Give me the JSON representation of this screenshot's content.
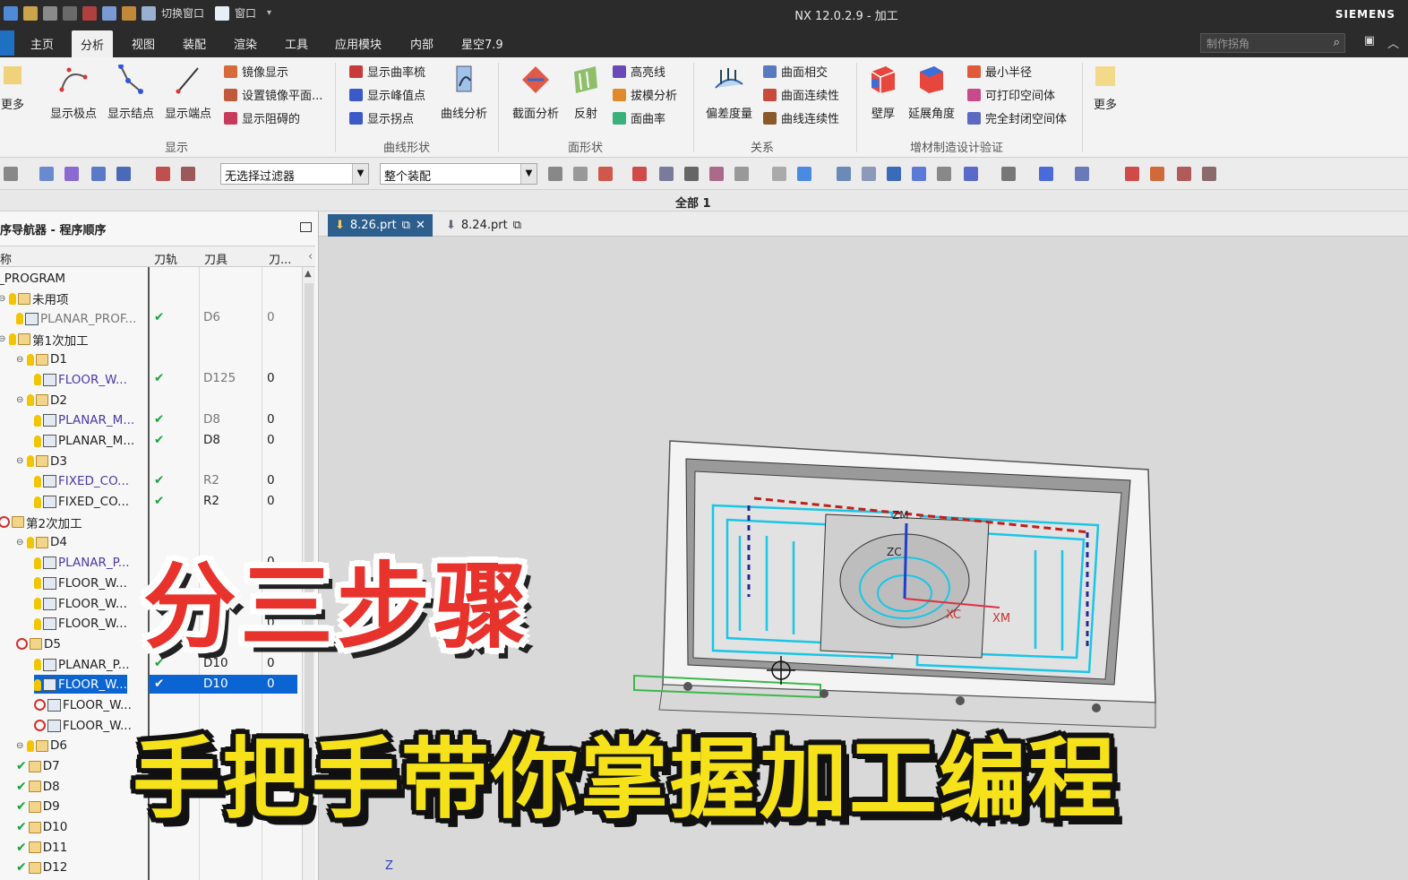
{
  "titlebar": {
    "quick_switch": "切换窗口",
    "quick_window": "窗口",
    "title": "NX 12.0.2.9 - 加工",
    "brand": "SIEMENS"
  },
  "menu": {
    "tabs": [
      "主页",
      "分析",
      "视图",
      "装配",
      "渲染",
      "工具",
      "应用模块",
      "内部",
      "星空7.9"
    ],
    "active": "分析",
    "search_placeholder": "制作拐角"
  },
  "ribbon": {
    "more_left": "更多",
    "display_group": {
      "label": "显示",
      "big_buttons": [
        "显示极点",
        "显示结点",
        "显示端点"
      ],
      "small_items": [
        "镜像显示",
        "设置镜像平面...",
        "显示阻碍的"
      ]
    },
    "curve_group": {
      "label": "曲线形状",
      "small_items": [
        "显示曲率梳",
        "显示峰值点",
        "显示拐点"
      ],
      "big_button": "曲线分析"
    },
    "face_group": {
      "label": "面形状",
      "big_buttons": [
        "截面分析",
        "反射"
      ],
      "small_items": [
        "高亮线",
        "拔模分析",
        "面曲率"
      ]
    },
    "relation_group": {
      "label": "关系",
      "big_button": "偏差度量",
      "small_items": [
        "曲面相交",
        "曲面连续性",
        "曲线连续性"
      ]
    },
    "additive_group": {
      "label": "增材制造设计验证",
      "big_buttons": [
        "壁厚",
        "延展角度"
      ],
      "small_items": [
        "最小半径",
        "可打印空间体",
        "完全封闭空间体"
      ]
    },
    "more_right": "更多"
  },
  "toolbar": {
    "filter": "无选择过滤器",
    "assembly": "整个装配"
  },
  "status": "全部 1",
  "navigator": {
    "title": "序导航器 - 程序顺序",
    "columns": [
      "称",
      "刀轨",
      "刀具",
      "刀..."
    ],
    "rows": [
      {
        "indent": 0,
        "name": "_PROGRAM",
        "kind": "root",
        "path": "",
        "tool": "",
        "n": ""
      },
      {
        "indent": 0,
        "name": "未用项",
        "kind": "folder",
        "path": "",
        "tool": "",
        "n": ""
      },
      {
        "indent": 1,
        "name": "PLANAR_PROF...",
        "kind": "op-muted",
        "path": "✔",
        "tool": "D6",
        "n": "0"
      },
      {
        "indent": 0,
        "name": "第1次加工",
        "kind": "folder",
        "path": "",
        "tool": "",
        "n": ""
      },
      {
        "indent": 1,
        "name": "D1",
        "kind": "folder",
        "path": "",
        "tool": "",
        "n": ""
      },
      {
        "indent": 2,
        "name": "FLOOR_W...",
        "kind": "op-purple",
        "path": "✔",
        "tool": "D125",
        "n": "0"
      },
      {
        "indent": 1,
        "name": "D2",
        "kind": "folder",
        "path": "",
        "tool": "",
        "n": ""
      },
      {
        "indent": 2,
        "name": "PLANAR_M...",
        "kind": "op-purple",
        "path": "✔",
        "tool": "D8",
        "n": "0"
      },
      {
        "indent": 2,
        "name": "PLANAR_M...",
        "kind": "op",
        "path": "✔",
        "tool": "D8",
        "n": "0"
      },
      {
        "indent": 1,
        "name": "D3",
        "kind": "folder",
        "path": "",
        "tool": "",
        "n": ""
      },
      {
        "indent": 2,
        "name": "FIXED_CO...",
        "kind": "op-purple",
        "path": "✔",
        "tool": "R2",
        "n": "0"
      },
      {
        "indent": 2,
        "name": "FIXED_CO...",
        "kind": "op",
        "path": "✔",
        "tool": "R2",
        "n": "0"
      },
      {
        "indent": 0,
        "name": "第2次加工",
        "kind": "folder-no",
        "path": "",
        "tool": "",
        "n": ""
      },
      {
        "indent": 1,
        "name": "D4",
        "kind": "folder",
        "path": "",
        "tool": "",
        "n": ""
      },
      {
        "indent": 2,
        "name": "PLANAR_P...",
        "kind": "op-purple",
        "path": "",
        "tool": "",
        "n": "0"
      },
      {
        "indent": 2,
        "name": "FLOOR_W...",
        "kind": "op",
        "path": "",
        "tool": "",
        "n": "0"
      },
      {
        "indent": 2,
        "name": "FLOOR_W...",
        "kind": "op",
        "path": "",
        "tool": "",
        "n": "0"
      },
      {
        "indent": 2,
        "name": "FLOOR_W...",
        "kind": "op",
        "path": "",
        "tool": "",
        "n": "0"
      },
      {
        "indent": 1,
        "name": "D5",
        "kind": "folder-no",
        "path": "",
        "tool": "",
        "n": ""
      },
      {
        "indent": 2,
        "name": "PLANAR_P...",
        "kind": "op",
        "path": "✔",
        "tool": "D10",
        "n": "0"
      },
      {
        "indent": 2,
        "name": "FLOOR_W...",
        "kind": "op-selected",
        "path": "✔",
        "tool": "D10",
        "n": "0"
      },
      {
        "indent": 2,
        "name": "FLOOR_W...",
        "kind": "op-no",
        "path": "",
        "tool": "",
        "n": ""
      },
      {
        "indent": 2,
        "name": "FLOOR_W...",
        "kind": "op-no",
        "path": "",
        "tool": "",
        "n": ""
      },
      {
        "indent": 1,
        "name": "D6",
        "kind": "folder",
        "path": "",
        "tool": "",
        "n": ""
      },
      {
        "indent": 1,
        "name": "D7",
        "kind": "folder-ok",
        "path": "",
        "tool": "",
        "n": ""
      },
      {
        "indent": 1,
        "name": "D8",
        "kind": "folder-ok",
        "path": "",
        "tool": "",
        "n": ""
      },
      {
        "indent": 1,
        "name": "D9",
        "kind": "folder-ok",
        "path": "",
        "tool": "",
        "n": ""
      },
      {
        "indent": 1,
        "name": "D10",
        "kind": "folder-ok",
        "path": "",
        "tool": "",
        "n": ""
      },
      {
        "indent": 1,
        "name": "D11",
        "kind": "folder-ok",
        "path": "",
        "tool": "",
        "n": ""
      },
      {
        "indent": 1,
        "name": "D12",
        "kind": "folder-ok",
        "path": "",
        "tool": "",
        "n": ""
      }
    ]
  },
  "doc_tabs": [
    "8.26.prt",
    "8.24.prt"
  ],
  "viewport": {
    "axis_labels": {
      "zc": "ZC",
      "xc": "XC",
      "xm": "XM",
      "zm": "ZM",
      "z": "Z"
    }
  },
  "overlay": {
    "line1": "分三步骤",
    "line2": "手把手带你掌握加工编程"
  },
  "colors": {
    "accent_blue": "#0a64d2",
    "title_dark": "#2b2b2b",
    "check_green": "#18a33a",
    "overlay_red": "#e8322c",
    "overlay_yellow": "#f6e21a",
    "toolpath_cyan": "#19c6e6"
  }
}
